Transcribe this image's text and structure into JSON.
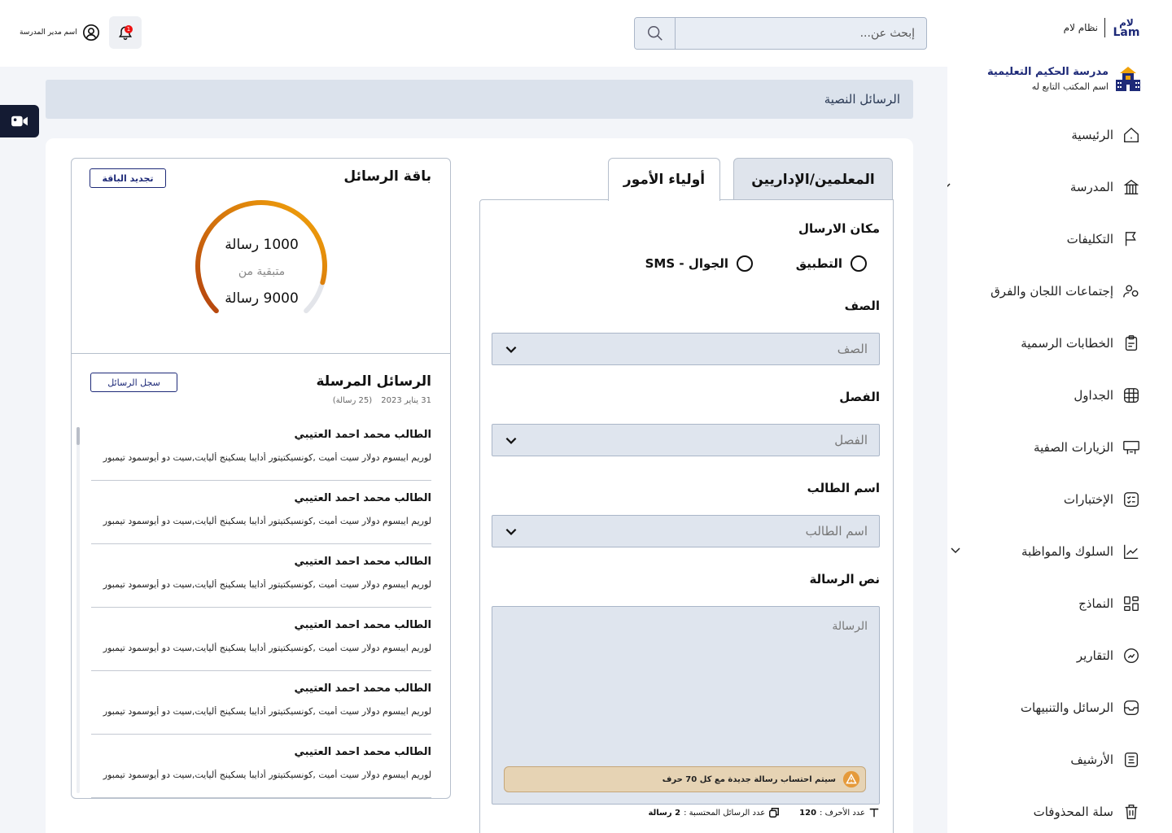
{
  "brand": {
    "logo_text": "Lam",
    "name": "نظام لام"
  },
  "school": {
    "name": "مدرسة الحكيم التعليمية",
    "office": "اسم المكتب التابع له"
  },
  "sidebar": {
    "items": [
      {
        "label": "الرئيسية",
        "icon": "home-icon"
      },
      {
        "label": "المدرسة",
        "icon": "building-icon",
        "expandable": true
      },
      {
        "label": "التكليفات",
        "icon": "flag-icon"
      },
      {
        "label": "إجتماعات اللجان والفرق",
        "icon": "users-icon"
      },
      {
        "label": "الخطابات الرسمية",
        "icon": "clipboard-icon"
      },
      {
        "label": "الجداول",
        "icon": "grid-icon"
      },
      {
        "label": "الزيارات الصفية",
        "icon": "classroom-icon"
      },
      {
        "label": "الإختبارات",
        "icon": "checklist-icon"
      },
      {
        "label": "السلوك والمواظبة",
        "icon": "chart-icon",
        "expandable": true
      },
      {
        "label": "النماذج",
        "icon": "layout-icon"
      },
      {
        "label": "التقارير",
        "icon": "report-icon"
      },
      {
        "label": "الرسائل والتنبيهات",
        "icon": "message-icon"
      },
      {
        "label": "الأرشيف",
        "icon": "archive-icon"
      },
      {
        "label": "سلة المحذوفات",
        "icon": "trash-icon"
      }
    ]
  },
  "topbar": {
    "search_placeholder": "إبحث عن...",
    "notification_count": "1",
    "user_name": "اسم مدير المدرسة"
  },
  "page": {
    "title": "الرسائل النصية"
  },
  "form": {
    "tabs": [
      {
        "label": "المعلمين/الإداريين",
        "active": false
      },
      {
        "label": "أولياء الأمور",
        "active": true
      }
    ],
    "send_place_label": "مكان الارسال",
    "radio_app": "التطبيق",
    "radio_sms": "الجوال - SMS",
    "grade_label": "الصف",
    "grade_placeholder": "الصف",
    "class_label": "الفصل",
    "class_placeholder": "الفصل",
    "student_label": "اسم الطالب",
    "student_placeholder": "اسم الطالب",
    "text_label": "نص الرسالة",
    "text_placeholder": "الرسالة",
    "warning": "سيتم احتساب رسالة جديدة مع كل 70 حرف",
    "char_count_label": "عدد الأحرف :",
    "char_count": "120",
    "msg_count_label": "عدد الرسائل المحتسبة :",
    "msg_count": "2 رسالة"
  },
  "package": {
    "title": "باقة الرسائل",
    "renew_label": "تجديد الباقة",
    "remaining": "1000 رسالة",
    "remaining_caption": "متبقية من",
    "total": "9000 رسالة",
    "remaining_fraction": 0.889,
    "accent": "#f0a20a"
  },
  "sent": {
    "title": "الرسائل المرسلة",
    "date": "31 يناير 2023",
    "count": "(25 رسالة)",
    "log_label": "سجل الرسائل",
    "messages": [
      {
        "name": "الطالب محمد احمد العتيبي",
        "text": "لوريم ايبسوم دولار سيت أميت ,كونسيكتيتور أدايبا يسكينج أليايت,سيت دو أيوسمود تيمبور"
      },
      {
        "name": "الطالب محمد احمد العتيبي",
        "text": "لوريم ايبسوم دولار سيت أميت ,كونسيكتيتور أدايبا يسكينج أليايت,سيت دو أيوسمود تيمبور"
      },
      {
        "name": "الطالب محمد احمد العتيبي",
        "text": "لوريم ايبسوم دولار سيت أميت ,كونسيكتيتور أدايبا يسكينج أليايت,سيت دو أيوسمود تيمبور"
      },
      {
        "name": "الطالب محمد احمد العتيبي",
        "text": "لوريم ايبسوم دولار سيت أميت ,كونسيكتيتور أدايبا يسكينج أليايت,سيت دو أيوسمود تيمبور"
      },
      {
        "name": "الطالب محمد احمد العتيبي",
        "text": "لوريم ايبسوم دولار سيت أميت ,كونسيكتيتور أدايبا يسكينج أليايت,سيت دو أيوسمود تيمبور"
      },
      {
        "name": "الطالب محمد احمد العتيبي",
        "text": "لوريم ايبسوم دولار سيت أميت ,كونسيكتيتور أدايبا يسكينج أليايت,سيت دو أيوسمود تيمبور"
      }
    ]
  }
}
